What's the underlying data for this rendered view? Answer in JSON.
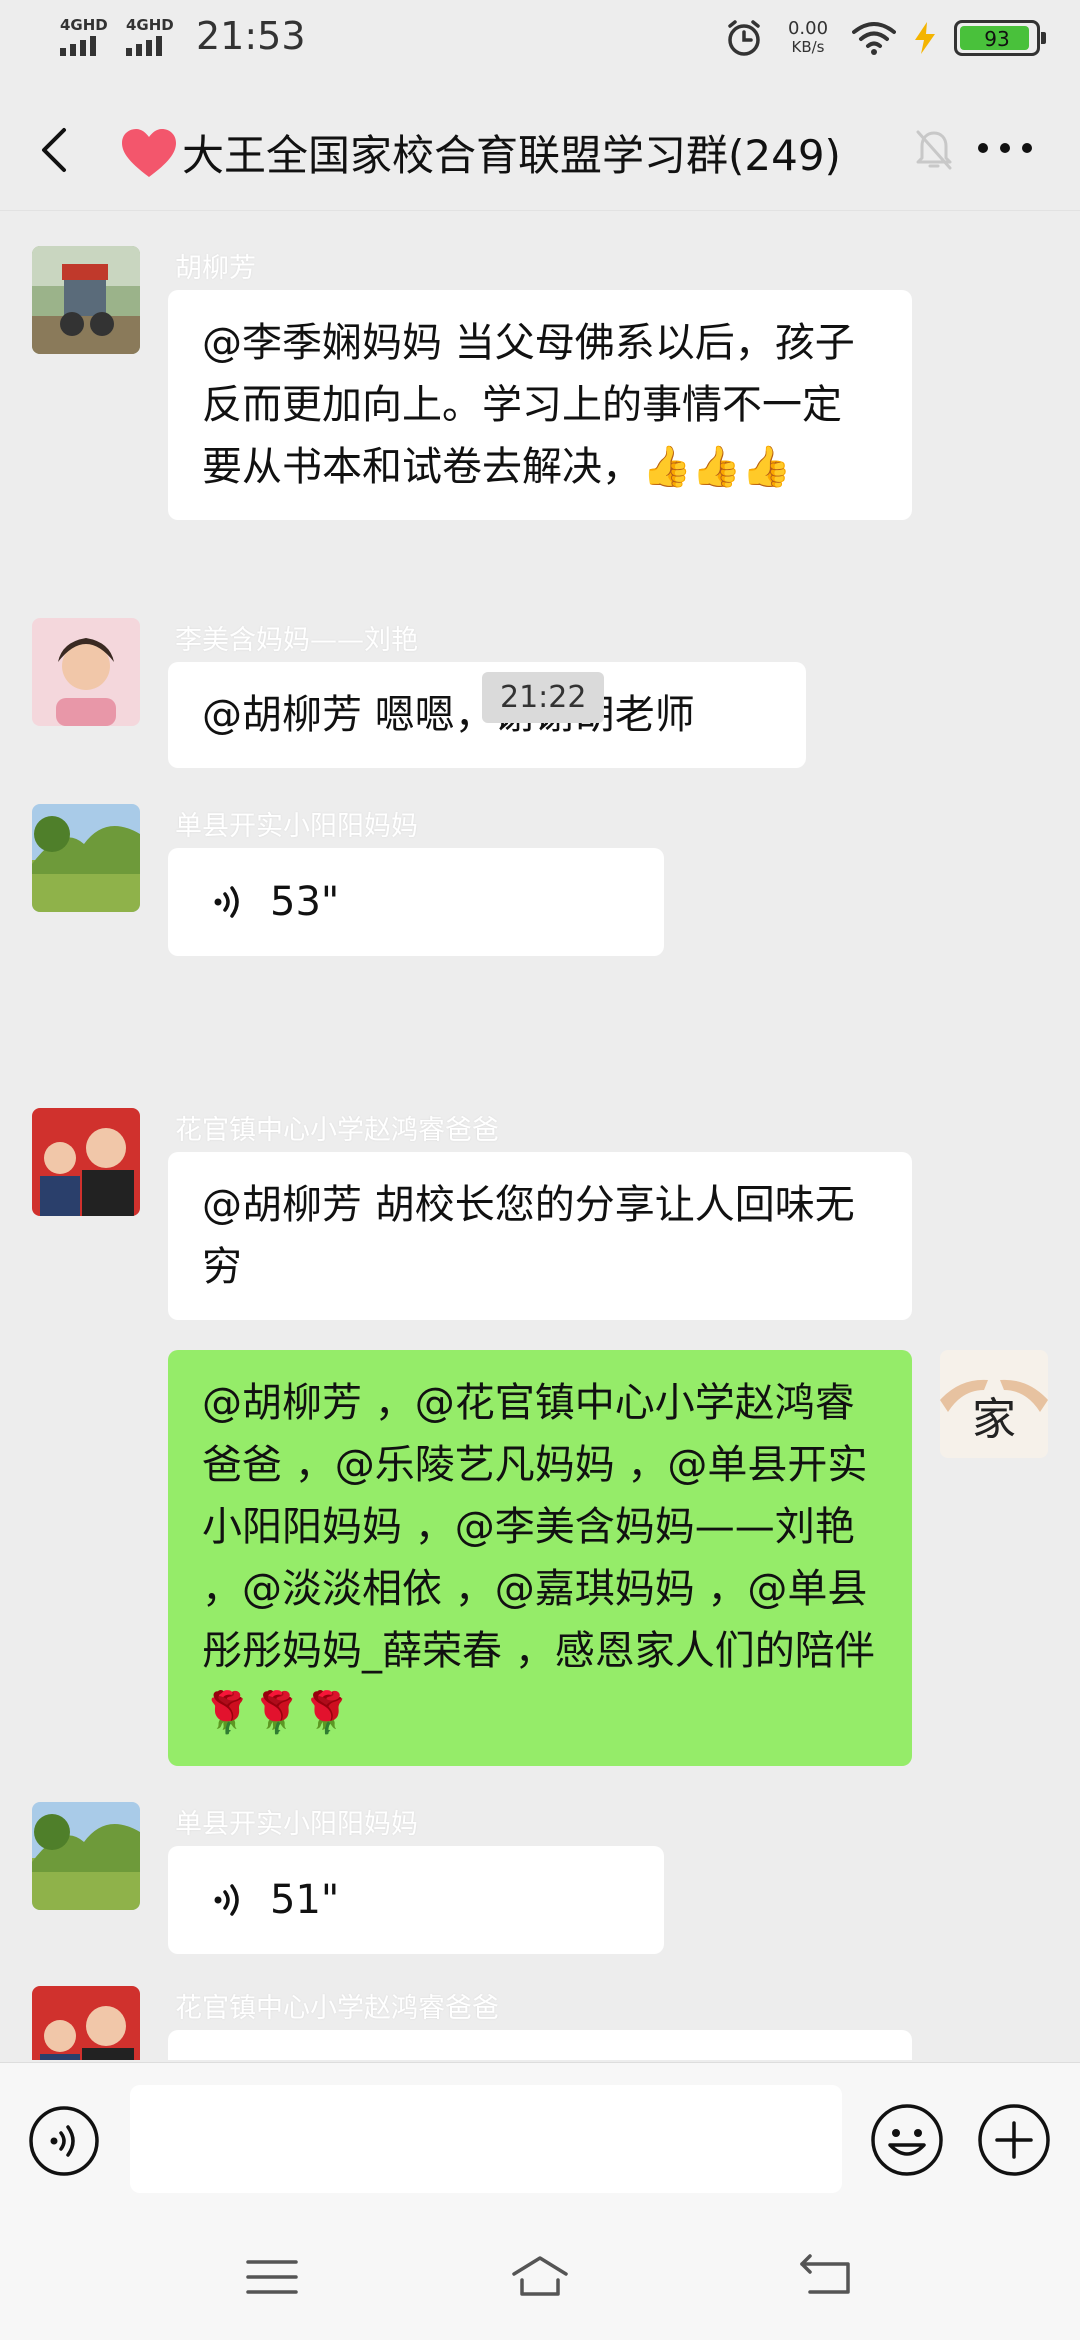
{
  "status_bar": {
    "network_1": "4GHD",
    "network_2": "4GHD",
    "time": "21:53",
    "speed_value": "0.00",
    "speed_unit": "KB/s",
    "battery": "93",
    "battery_level": 0.93
  },
  "header": {
    "title": "大王全国家校合育联盟学习群(249)"
  },
  "messages": [
    {
      "sender": "胡柳芳",
      "text": "@李季娴妈妈  当父母佛系以后，孩子反而更加向上。学习上的事情不一定要从书本和试卷去解决，👍👍👍"
    },
    {
      "sender": "李美含妈妈——刘艳",
      "text": "@胡柳芳  嗯嗯，谢谢胡老师"
    },
    {
      "sender": "单县开实小阳阳妈妈",
      "voice_duration": "53\""
    },
    {
      "time": "21:22"
    },
    {
      "sender": "花官镇中心小学赵鸿睿爸爸",
      "text": "@胡柳芳  胡校长您的分享让人回味无穷"
    },
    {
      "self": true,
      "text": "@胡柳芳 ，@花官镇中心小学赵鸿睿爸爸 ，@乐陵艺凡妈妈 ，@单县开实小阳阳妈妈 ，@李美含妈妈——刘艳 ，@淡淡相依 ，@嘉琪妈妈 ，@单县彤彤妈妈_薛荣春 ，感恩家人们的陪伴🌹🌹🌹",
      "avatar_text": "家"
    },
    {
      "sender": "单县开实小阳阳妈妈",
      "voice_duration": "51\""
    },
    {
      "sender": "花官镇中心小学赵鸿睿爸爸"
    }
  ],
  "colors": {
    "background": "#ededed",
    "self_bubble": "#95ec69",
    "other_bubble": "#ffffff",
    "battery": "#49c13b"
  }
}
